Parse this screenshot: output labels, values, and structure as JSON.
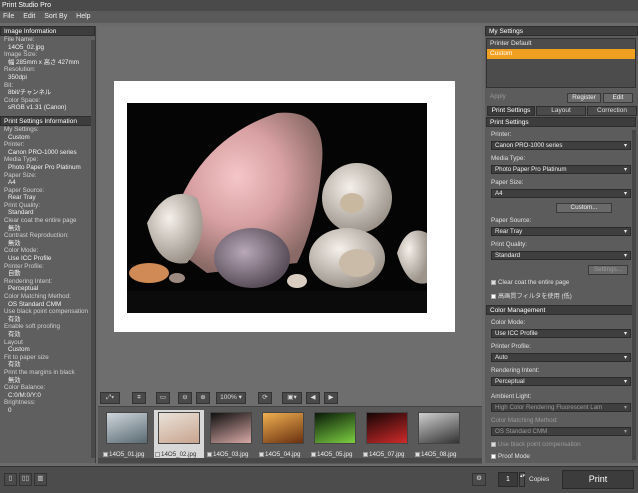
{
  "app": {
    "title": "Print Studio Pro"
  },
  "menu": [
    "File",
    "Edit",
    "Sort By",
    "Help"
  ],
  "image_info": {
    "header": "Image Information",
    "rows": [
      {
        "k": "File Name:",
        "v": "14O5_02.jpg"
      },
      {
        "k": "Image Size:",
        "v": "幅 285mm x 高さ 427mm"
      },
      {
        "k": "Resolution:",
        "v": "350dpi"
      },
      {
        "k": "Bit:",
        "v": "8bit/チャンネル"
      },
      {
        "k": "Color Space:",
        "v": "sRGB v1.31 (Canon)"
      }
    ]
  },
  "print_info": {
    "header": "Print Settings Information",
    "rows": [
      {
        "k": "My Settings:",
        "v": "Custom"
      },
      {
        "k": "Printer:",
        "v": "Canon PRO-1000 series"
      },
      {
        "k": "Media Type:",
        "v": "Photo Paper Pro Platinum"
      },
      {
        "k": "Paper Size:",
        "v": "A4"
      },
      {
        "k": "Paper Source:",
        "v": "Rear Tray"
      },
      {
        "k": "Print Quality:",
        "v": "Standard"
      },
      {
        "k": "Clear coat the entire page",
        "v": "無効"
      },
      {
        "k": "Contrast Reproduction:",
        "v": "無効"
      },
      {
        "k": "Color Mode:",
        "v": "Use ICC Profile"
      },
      {
        "k": "Printer Profile:",
        "v": "自動"
      },
      {
        "k": "Rendering Intent:",
        "v": "Perceptual"
      },
      {
        "k": "Color Matching Method:",
        "v": "OS Standard CMM"
      },
      {
        "k": "Use black point compensation",
        "v": "有効"
      },
      {
        "k": "Enable soft proofing",
        "v": "有効"
      },
      {
        "k": "Layout",
        "v": "Custom"
      },
      {
        "k": "Fit to paper size",
        "v": "有効"
      },
      {
        "k": "Print the margins in black",
        "v": "無効"
      },
      {
        "k": "Color Balance:",
        "v": "C:0/M:0/Y:0"
      },
      {
        "k": "Brightness:",
        "v": "0"
      }
    ]
  },
  "viewbar": {
    "zoom": "100%"
  },
  "thumbnails": [
    {
      "label": "14O5_01.jpg",
      "colors": [
        "#cfd6dc",
        "#5a6a72"
      ]
    },
    {
      "label": "14O5_02.jpg",
      "colors": [
        "#e9e2d8",
        "#c9a48f"
      ],
      "selected": true
    },
    {
      "label": "14O5_03.jpg",
      "colors": [
        "#101010",
        "#d8a9a6"
      ]
    },
    {
      "label": "14O5_04.jpg",
      "colors": [
        "#f0b050",
        "#6a3010"
      ]
    },
    {
      "label": "14O5_05.jpg",
      "colors": [
        "#0a1a0a",
        "#7cd040"
      ]
    },
    {
      "label": "14O5_07.jpg",
      "colors": [
        "#150505",
        "#d02a2a"
      ]
    },
    {
      "label": "14O5_08.jpg",
      "colors": [
        "#cfcfcf",
        "#333333"
      ]
    }
  ],
  "bottom": {
    "copies_label": "Copies",
    "copies": "1",
    "print": "Print"
  },
  "my_settings": {
    "header": "My Settings",
    "items": [
      "Printer Default",
      "Custom"
    ],
    "apply": "Apply",
    "register": "Register",
    "edit": "Edit"
  },
  "tabs": [
    "Print Settings",
    "Layout",
    "Correction"
  ],
  "print_settings": {
    "header": "Print Settings",
    "printer_label": "Printer:",
    "printer": "Canon PRO-1000 series",
    "media_label": "Media Type:",
    "media": "Photo Paper Pro Platinum",
    "size_label": "Paper Size:",
    "size": "A4",
    "custom": "Custom...",
    "source_label": "Paper Source:",
    "source": "Rear Tray",
    "quality_label": "Print Quality:",
    "quality": "Standard",
    "settings": "Settings...",
    "clear_coat": "Clear coat the entire page",
    "hq_filter": "高画質フィルタを使用 (低)"
  },
  "color_mgmt": {
    "header": "Color Management",
    "mode_label": "Color Mode:",
    "mode": "Use ICC Profile",
    "profile_label": "Printer Profile:",
    "profile": "Auto",
    "intent_label": "Rendering Intent:",
    "intent": "Perceptual",
    "ambient_label": "Ambient Light:",
    "ambient": "High Color Rendering Fluorescent Lam",
    "method_label": "Color Matching Method:",
    "method": "OS Standard CMM",
    "blackpoint": "Use black point compensation",
    "proof": "Proof Mode"
  },
  "colors": {
    "accent": "#f0a020",
    "panel": "#5c5c5c",
    "header": "#3d3d3d"
  }
}
